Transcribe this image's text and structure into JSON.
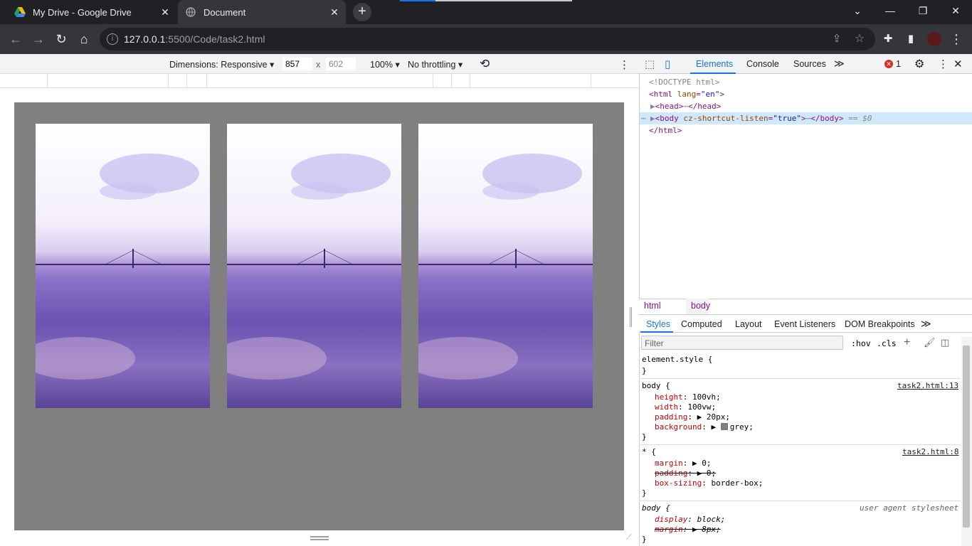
{
  "browser": {
    "tabs": [
      {
        "title": "My Drive - Google Drive",
        "icon": "google-drive-icon"
      },
      {
        "title": "Document",
        "icon": "globe-icon"
      }
    ],
    "url_host": "127.0.0.1",
    "url_path": ":5500/Code/task2.html"
  },
  "device_toolbar": {
    "dimensions_label": "Dimensions: Responsive",
    "width": "857",
    "times": "x",
    "height": "602",
    "zoom": "100%",
    "throttling": "No throttling"
  },
  "devtools": {
    "tabs": [
      "Elements",
      "Console",
      "Sources"
    ],
    "error_count": "1",
    "dom": {
      "doctype": "<!DOCTYPE html>",
      "html_open_tag": "<html",
      "html_lang_attr": "lang",
      "html_lang_val": "\"en\"",
      "head_open": "<head>",
      "head_close": "</head>",
      "body_open": "<body",
      "body_attr": "cz-shortcut-listen",
      "body_attr_val": "\"true\"",
      "body_close": "</body>",
      "body_eq": "== $0",
      "html_close": "</html>"
    },
    "breadcrumbs": [
      "html",
      "body"
    ],
    "styles_tabs": [
      "Styles",
      "Computed",
      "Layout",
      "Event Listeners",
      "DOM Breakpoints"
    ],
    "filter_placeholder": "Filter",
    "hov": ":hov",
    "cls": ".cls",
    "rules": {
      "element_style": "element.style {",
      "close": "}",
      "body_selector": "body {",
      "body_source": "task2.html:13",
      "body_props": [
        {
          "name": "height",
          "value": "100vh;"
        },
        {
          "name": "width",
          "value": "100vw;"
        },
        {
          "name": "padding",
          "value": "20px;"
        },
        {
          "name": "background",
          "value": "grey;"
        }
      ],
      "star_selector": "* {",
      "star_source": "task2.html:8",
      "star_props": [
        {
          "name": "margin",
          "value": "0;"
        },
        {
          "name": "padding",
          "value": "0;"
        },
        {
          "name": "box-sizing",
          "value": "border-box;"
        }
      ],
      "ua_selector": "body {",
      "ua_source": "user agent stylesheet",
      "ua_props": [
        {
          "name": "display",
          "value": "block;"
        },
        {
          "name": "margin",
          "value": "8px;"
        }
      ]
    }
  }
}
